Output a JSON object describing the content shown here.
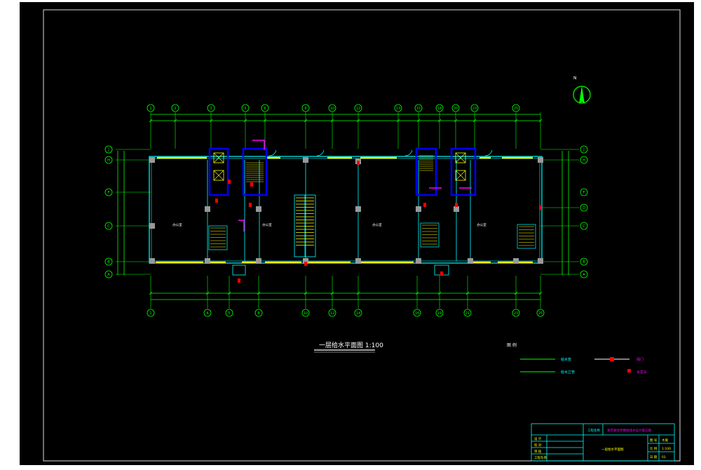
{
  "drawing": {
    "title": "一层给水平面图 1:100",
    "north_label": "N"
  },
  "axes_top": [
    "1",
    "2",
    "3",
    "5",
    "6",
    "8",
    "10",
    "12",
    "13",
    "15",
    "18",
    "20",
    "23",
    "25"
  ],
  "axes_bottom": [
    "1",
    "4",
    "5",
    "8",
    "10",
    "12",
    "14",
    "16",
    "19",
    "21",
    "23",
    "25"
  ],
  "axes_left": [
    "J",
    "H",
    "F",
    "C",
    "B",
    "A"
  ],
  "axes_right": [
    "J",
    "H",
    "F",
    "D",
    "C",
    "B",
    "A"
  ],
  "rooms": [
    "办公室",
    "办公室",
    "办公室",
    "办公室"
  ],
  "legend": {
    "heading": "图 例",
    "items": [
      "给水管",
      "给水立管",
      "阀门",
      "水龙头"
    ]
  },
  "title_block": {
    "company": "工程名称",
    "project": "某市某住宅楼给排水设计施工图",
    "drawing_name": "一层给水平面图",
    "rows": [
      "设 计",
      "校 对",
      "审 核",
      "工程负责"
    ],
    "right_labels": [
      "图 号",
      "比 例",
      "日 期"
    ],
    "right_values": [
      "水施",
      "1:100",
      "01"
    ]
  },
  "colors": {
    "background": "#000000",
    "frame": "#ffffff",
    "dimension": "#00ff00",
    "wall": "#00ffff",
    "window": "#ffff00",
    "elevator": "#0000ff",
    "fixture": "#ff00ff",
    "pipe_red": "#ff0000",
    "text": "#ffffff"
  }
}
